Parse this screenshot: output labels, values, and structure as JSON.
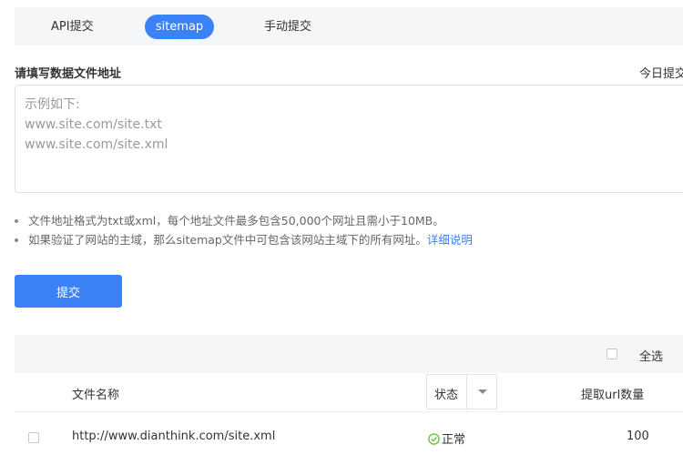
{
  "tabs": [
    {
      "label": "API提交",
      "active": false
    },
    {
      "label": "sitemap",
      "active": true
    },
    {
      "label": "手动提交",
      "active": false
    }
  ],
  "form": {
    "title": "请填写数据文件地址",
    "today_label": "今日提交",
    "placeholder": "示例如下:\nwww.site.com/site.txt\nwww.site.com/site.xml"
  },
  "notes": [
    {
      "text": "文件地址格式为txt或xml，每个地址文件最多包含50,000个网址且需小于10MB。",
      "link": ""
    },
    {
      "text": "如果验证了网站的主域，那么sitemap文件中可包含该网站主域下的所有网址。",
      "link": "详细说明"
    }
  ],
  "submit_label": "提交",
  "table": {
    "select_all_label": "全选",
    "columns": {
      "name": "文件名称",
      "status": "状态",
      "count": "提取url数量"
    },
    "rows": [
      {
        "url": "http://www.dianthink.com/site.xml",
        "status": "正常",
        "count": "100"
      }
    ]
  },
  "colors": {
    "accent": "#3b82f6",
    "success": "#52c41a",
    "bar_bg": "#f5f6f7"
  }
}
